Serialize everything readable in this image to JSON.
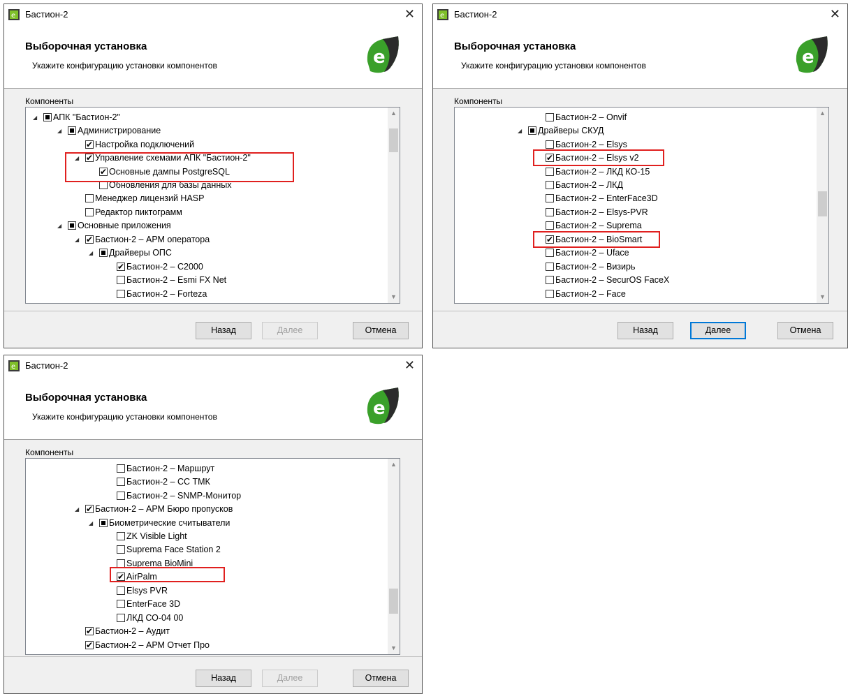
{
  "dialogs": [
    {
      "title": "Бастион-2",
      "heading": "Выборочная установка",
      "subtitle": "Укажите конфигурацию установки компонентов",
      "group_label": "Компоненты",
      "buttons": {
        "back": "Назад",
        "next": "Далее",
        "cancel": "Отмена"
      },
      "next_enabled": false,
      "rows": [
        {
          "text": "АПК \"Бастион-2\"",
          "check": "partial",
          "expander": true
        },
        {
          "text": "Администрирование",
          "check": "partial",
          "expander": true
        },
        {
          "text": "Настройка подключений",
          "check": "checked",
          "expander": false
        },
        {
          "text": "Управление схемами АПК \"Бастион-2\"",
          "check": "checked",
          "expander": true
        },
        {
          "text": "Основные дампы PostgreSQL",
          "check": "checked",
          "expander": false
        },
        {
          "text": "Обновления для базы данных",
          "check": "unchecked",
          "expander": false
        },
        {
          "text": "Менеджер лицензий HASP",
          "check": "unchecked",
          "expander": false
        },
        {
          "text": "Редактор пиктограмм",
          "check": "unchecked",
          "expander": false
        },
        {
          "text": "Основные приложения",
          "check": "partial",
          "expander": true
        },
        {
          "text": "Бастион-2 – АРМ оператора",
          "check": "checked",
          "expander": true
        },
        {
          "text": "Драйверы ОПС",
          "check": "partial",
          "expander": true
        },
        {
          "text": "Бастион-2 – С2000",
          "check": "checked",
          "expander": false
        },
        {
          "text": "Бастион-2 – Esmi FX Net",
          "check": "unchecked",
          "expander": false
        },
        {
          "text": "Бастион-2 – Forteza",
          "check": "unchecked",
          "expander": false
        }
      ]
    },
    {
      "title": "Бастион-2",
      "heading": "Выборочная установка",
      "subtitle": "Укажите конфигурацию установки компонентов",
      "group_label": "Компоненты",
      "buttons": {
        "back": "Назад",
        "next": "Далее",
        "cancel": "Отмена"
      },
      "next_enabled": true,
      "rows": [
        {
          "text": "Бастион-2 – Onvif",
          "check": "unchecked",
          "expander": false
        },
        {
          "text": "Драйверы СКУД",
          "check": "partial",
          "expander": true
        },
        {
          "text": "Бастион-2 – Elsys",
          "check": "unchecked",
          "expander": false
        },
        {
          "text": "Бастион-2 – Elsys v2",
          "check": "checked",
          "expander": false
        },
        {
          "text": "Бастион-2 – ЛКД КО-15",
          "check": "unchecked",
          "expander": false
        },
        {
          "text": "Бастион-2 – ЛКД",
          "check": "unchecked",
          "expander": false
        },
        {
          "text": "Бастион-2 – EnterFace3D",
          "check": "unchecked",
          "expander": false
        },
        {
          "text": "Бастион-2 – Elsys-PVR",
          "check": "unchecked",
          "expander": false
        },
        {
          "text": "Бастион-2 – Suprema",
          "check": "unchecked",
          "expander": false
        },
        {
          "text": "Бастион-2 – BioSmart",
          "check": "checked",
          "expander": false
        },
        {
          "text": "Бастион-2 – Uface",
          "check": "unchecked",
          "expander": false
        },
        {
          "text": "Бастион-2 – Визирь",
          "check": "unchecked",
          "expander": false
        },
        {
          "text": "Бастион-2 – SecurOS FaceX",
          "check": "unchecked",
          "expander": false
        },
        {
          "text": "Бастион-2 – Face",
          "check": "unchecked",
          "expander": false
        }
      ]
    },
    {
      "title": "Бастион-2",
      "heading": "Выборочная установка",
      "subtitle": "Укажите конфигурацию установки компонентов",
      "group_label": "Компоненты",
      "buttons": {
        "back": "Назад",
        "next": "Далее",
        "cancel": "Отмена"
      },
      "next_enabled": false,
      "rows": [
        {
          "text": "Бастион-2 – Маршрут",
          "check": "unchecked",
          "expander": false
        },
        {
          "text": "Бастион-2 – СС ТМК",
          "check": "unchecked",
          "expander": false
        },
        {
          "text": "Бастион-2 – SNMP-Монитор",
          "check": "unchecked",
          "expander": false
        },
        {
          "text": "Бастион-2 – АРМ Бюро пропусков",
          "check": "checked",
          "expander": true
        },
        {
          "text": "Биометрические считыватели",
          "check": "partial",
          "expander": true
        },
        {
          "text": "ZK Visible Light",
          "check": "unchecked",
          "expander": false
        },
        {
          "text": "Suprema Face Station 2",
          "check": "unchecked",
          "expander": false
        },
        {
          "text": "Suprema BioMini",
          "check": "unchecked",
          "expander": false
        },
        {
          "text": "AirPalm",
          "check": "checked",
          "expander": false
        },
        {
          "text": "Elsys PVR",
          "check": "unchecked",
          "expander": false
        },
        {
          "text": "EnterFace 3D",
          "check": "unchecked",
          "expander": false
        },
        {
          "text": "ЛКД СО-04 00",
          "check": "unchecked",
          "expander": false
        },
        {
          "text": "Бастион-2 – Аудит",
          "check": "checked",
          "expander": false
        },
        {
          "text": "Бастион-2 – АРМ Отчет Про",
          "check": "checked",
          "expander": false
        }
      ]
    }
  ]
}
